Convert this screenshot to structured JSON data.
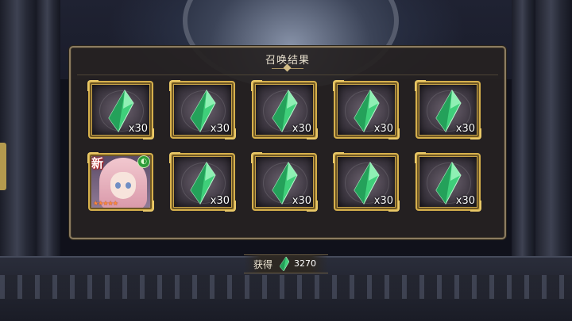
{
  "dialog": {
    "title": "召唤结果"
  },
  "rewards": [
    {
      "type": "crystal",
      "quantity": "x30"
    },
    {
      "type": "crystal",
      "quantity": "x30"
    },
    {
      "type": "crystal",
      "quantity": "x30"
    },
    {
      "type": "crystal",
      "quantity": "x30"
    },
    {
      "type": "crystal",
      "quantity": "x30"
    },
    {
      "type": "character",
      "new_badge": "新",
      "stars": "★★★★★",
      "element_icon": "wind-element-icon"
    },
    {
      "type": "crystal",
      "quantity": "x30"
    },
    {
      "type": "crystal",
      "quantity": "x30"
    },
    {
      "type": "crystal",
      "quantity": "x30"
    },
    {
      "type": "crystal",
      "quantity": "x30"
    }
  ],
  "footer": {
    "label": "获得",
    "currency_icon": "green-crystal-icon",
    "amount": "3270"
  },
  "colors": {
    "frame_gold": "#d6b04c",
    "crystal_green": "#3fcf7a",
    "panel_bg": "#262222",
    "new_badge_red": "#b12020"
  }
}
